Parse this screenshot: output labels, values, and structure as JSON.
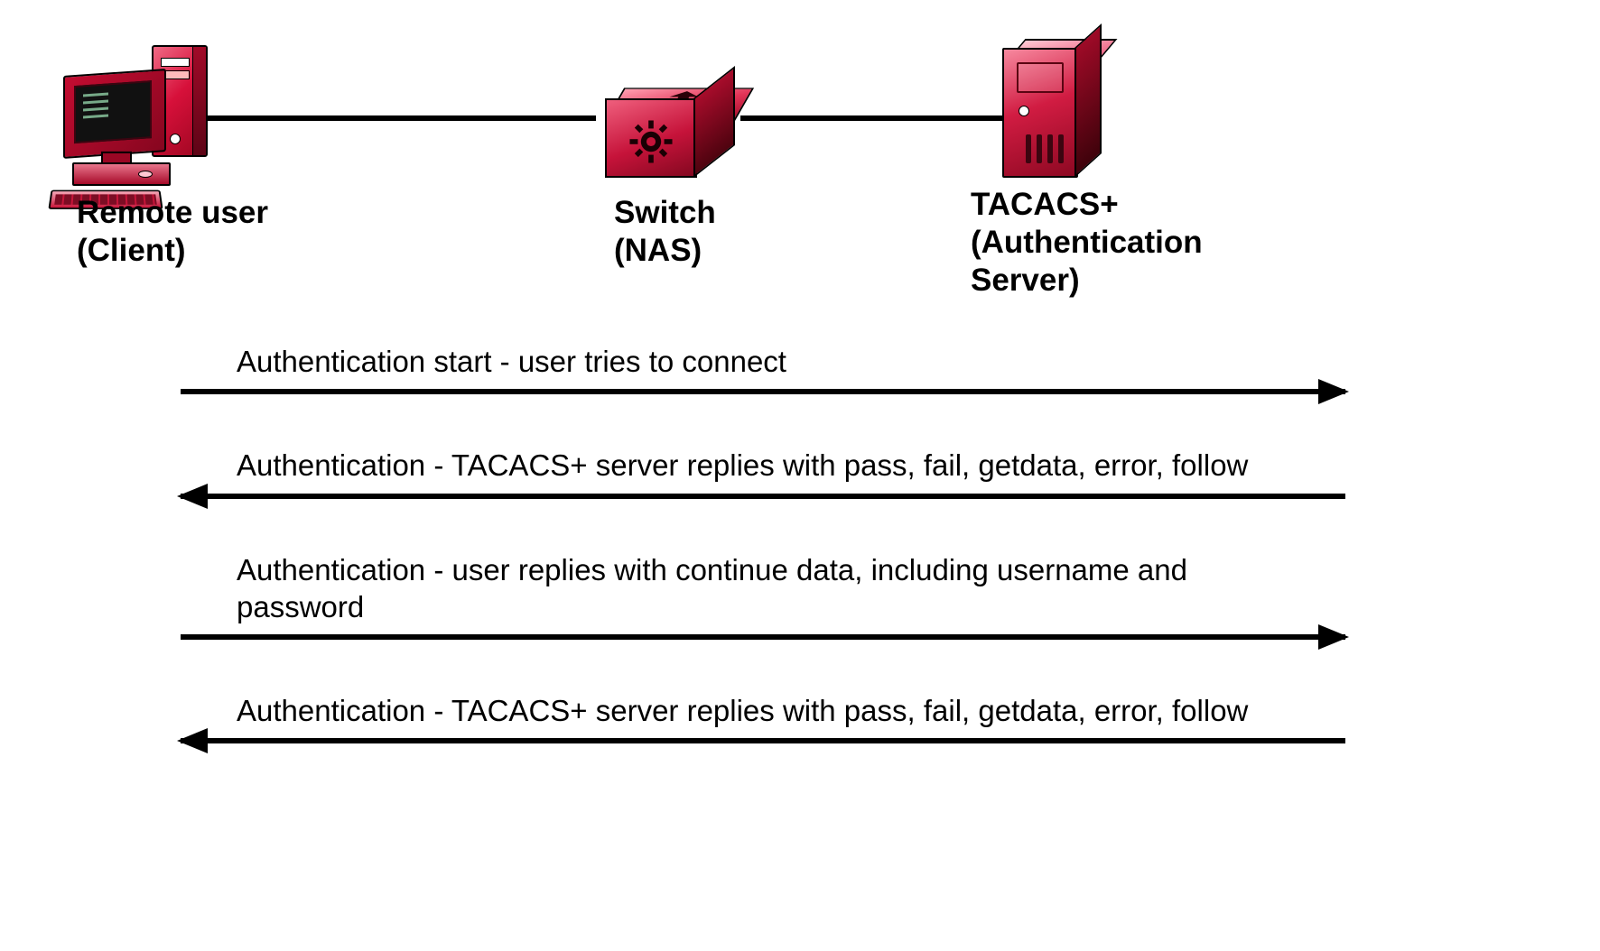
{
  "nodes": {
    "client": {
      "label_line1": "Remote user",
      "label_line2": "(Client)"
    },
    "switch": {
      "label_line1": "Switch",
      "label_line2": "(NAS)"
    },
    "server": {
      "label_line1": "TACACS+",
      "label_line2": "(Authentication",
      "label_line3": "Server)"
    }
  },
  "flows": [
    {
      "direction": "right",
      "text": "Authentication start - user tries to connect"
    },
    {
      "direction": "left",
      "text": "Authentication - TACACS+ server replies with  pass, fail, getdata, error, follow"
    },
    {
      "direction": "right",
      "text": "Authentication - user replies with continue data, including username and password"
    },
    {
      "direction": "left",
      "text": "Authentication - TACACS+ server replies with pass, fail, getdata, error, follow"
    }
  ],
  "colors": {
    "accent": "#d11c42",
    "line": "#000000"
  }
}
